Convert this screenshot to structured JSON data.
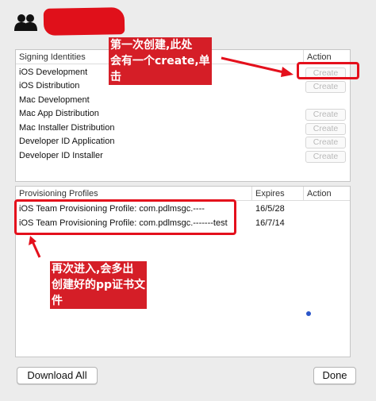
{
  "certificates": {
    "header": {
      "name": "Signing Identities",
      "action": "Action"
    },
    "rows": [
      {
        "name": "iOS Development",
        "action": "Create"
      },
      {
        "name": "iOS Distribution",
        "action": "Create"
      },
      {
        "name": "Mac Development",
        "action": ""
      },
      {
        "name": "Mac App Distribution",
        "action": "Create"
      },
      {
        "name": "Mac Installer Distribution",
        "action": "Create"
      },
      {
        "name": "Developer ID Application",
        "action": "Create"
      },
      {
        "name": "Developer ID Installer",
        "action": "Create"
      }
    ]
  },
  "profiles": {
    "header": {
      "name": "Provisioning Profiles",
      "expires": "Expires",
      "action": "Action"
    },
    "rows": [
      {
        "name": "iOS Team Provisioning Profile: com.pdlmsgc.----",
        "expires": "16/5/28"
      },
      {
        "name": "iOS Team Provisioning Profile: com.pdlmsgc.-------test",
        "expires": "16/7/14"
      }
    ]
  },
  "buttons": {
    "download_all": "Download All",
    "done": "Done"
  },
  "annotations": {
    "create_note": [
      "第一次创建,此处",
      "会有一个create,单",
      "击"
    ],
    "profiles_note": [
      "再次进入,会多出",
      "创建好的pp证书文",
      "件"
    ]
  },
  "colors": {
    "annotation_red": "#e4101c",
    "accent_blue": "#2a55c9"
  }
}
